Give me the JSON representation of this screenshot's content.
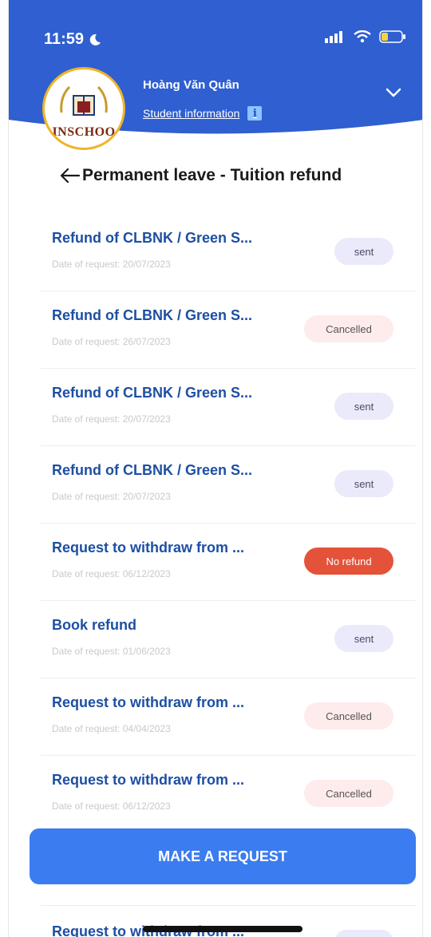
{
  "status_bar": {
    "time": "11:59"
  },
  "header": {
    "user_name": "Hoàng Văn Quân",
    "student_info_label": "Student information",
    "logo_text": "INSCHOO",
    "brand_color": "#2f5fd0"
  },
  "page": {
    "title": "Permanent leave - Tuition refund"
  },
  "requests": [
    {
      "title": "Refund of CLBNK / Green S...",
      "date": "Date of request: 20/07/2023",
      "status": "sent",
      "type": "sent"
    },
    {
      "title": "Refund of CLBNK / Green S...",
      "date": "Date of request: 26/07/2023",
      "status": "Cancelled",
      "type": "cancelled"
    },
    {
      "title": "Refund of CLBNK / Green S...",
      "date": "Date of request: 20/07/2023",
      "status": "sent",
      "type": "sent"
    },
    {
      "title": "Refund of CLBNK / Green S...",
      "date": "Date of request: 20/07/2023",
      "status": "sent",
      "type": "sent"
    },
    {
      "title": "Request to withdraw from ...",
      "date": "Date of request: 06/12/2023",
      "status": "No refund",
      "type": "norefund"
    },
    {
      "title": "Book refund",
      "date": "Date of request: 01/06/2023",
      "status": "sent",
      "type": "sent"
    },
    {
      "title": "Request to withdraw from ...",
      "date": "Date of request: 04/04/2023",
      "status": "Cancelled",
      "type": "cancelled"
    },
    {
      "title": "Request to withdraw from ...",
      "date": "Date of request: 06/12/2023",
      "status": "Cancelled",
      "type": "cancelled"
    }
  ],
  "partial_request": {
    "title": "Request to withdraw from ..."
  },
  "cta": {
    "label": "MAKE A REQUEST"
  },
  "colors": {
    "accent": "#3b7cf0",
    "title_blue": "#1d4fa3",
    "no_refund": "#e5523a",
    "sent_bg": "#ebeafa",
    "cancelled_bg": "#fdeceb"
  }
}
